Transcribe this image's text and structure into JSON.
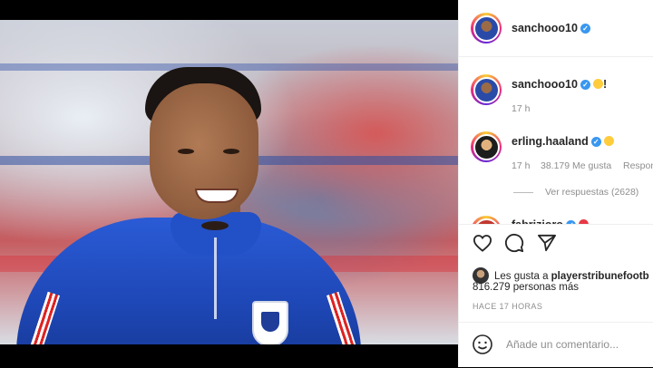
{
  "post": {
    "author": "sanchooo10",
    "photo_alt_icon": "player-photo"
  },
  "comments": [
    {
      "user": "sanchooo10",
      "emoji": "grinning-face",
      "suffix": "!",
      "time": "17 h",
      "likes": "",
      "reply": ""
    },
    {
      "user": "erling.haaland",
      "emoji": "crying-face",
      "suffix": "",
      "time": "17 h",
      "likes": "38.179 Me gusta",
      "reply": "Respon"
    },
    {
      "user": "fabrizioro",
      "emoji": "emoji-row",
      "suffix": "",
      "time": "",
      "likes": "",
      "reply": ""
    }
  ],
  "view_replies": "Ver respuestas (2628)",
  "likes": {
    "prefix": "Les gusta a ",
    "user": "playerstribunefootb",
    "count_text": "816.279 personas más"
  },
  "time_ago": "HACE 17 HORAS",
  "add_comment": {
    "placeholder": "Añade un comentario..."
  },
  "icons": {
    "verified": "verified-badge-icon",
    "like": "heart-icon",
    "comment": "comment-bubble-icon",
    "share": "paper-plane-icon",
    "emoji": "smiley-icon"
  },
  "colors": {
    "verified_blue": "#3897f0",
    "muted_text": "#8e8e8e",
    "jersey_blue": "#2a5bd6"
  }
}
